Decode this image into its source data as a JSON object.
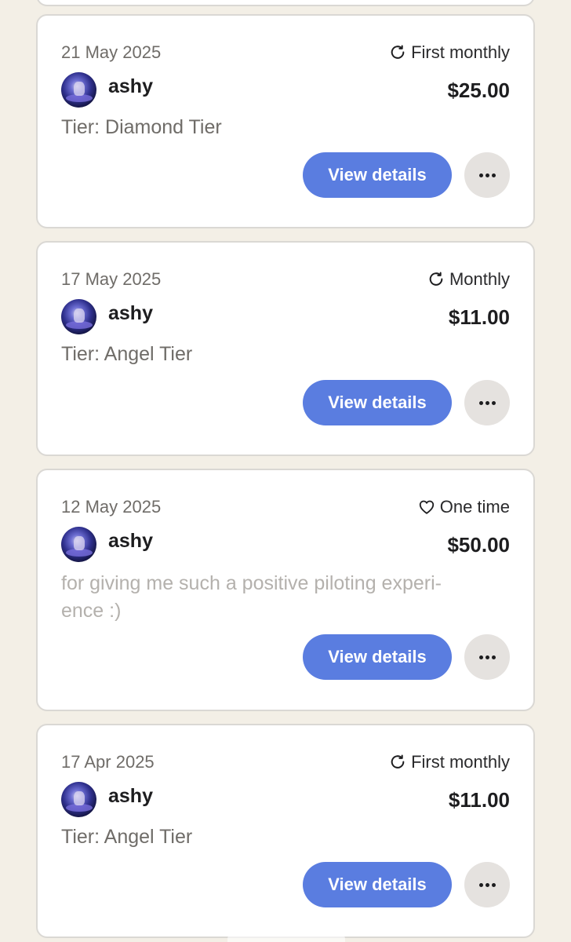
{
  "transactions": [
    {
      "date": "21 May 2025",
      "type": "First monthly",
      "type_icon": "refresh-icon",
      "user": "ashy",
      "amount": "$25.00",
      "detail": "Tier: Diamond Tier",
      "detail_kind": "tier",
      "view_label": "View details",
      "more_icon": "ellipsis-icon"
    },
    {
      "date": "17 May 2025",
      "type": "Monthly",
      "type_icon": "refresh-icon",
      "user": "ashy",
      "amount": "$11.00",
      "detail": "Tier: Angel Tier",
      "detail_kind": "tier",
      "view_label": "View details",
      "more_icon": "ellipsis-icon"
    },
    {
      "date": "12 May 2025",
      "type": "One time",
      "type_icon": "heart-icon",
      "user": "ashy",
      "amount": "$50.00",
      "detail": "for giving me such a positive piloting experi-\nence :)",
      "detail_kind": "note",
      "view_label": "View details",
      "more_icon": "ellipsis-icon"
    },
    {
      "date": "17 Apr 2025",
      "type": "First monthly",
      "type_icon": "refresh-icon",
      "user": "ashy",
      "amount": "$11.00",
      "detail": "Tier: Angel Tier",
      "detail_kind": "tier",
      "view_label": "View details",
      "more_icon": "ellipsis-icon"
    }
  ],
  "colors": {
    "background": "#f3efe6",
    "card": "#ffffff",
    "card_border": "#dad8d4",
    "accent": "#5a7de0",
    "muted_text": "#6f6c68",
    "note_text": "#b4b1ad",
    "more_button": "#e5e2df"
  }
}
